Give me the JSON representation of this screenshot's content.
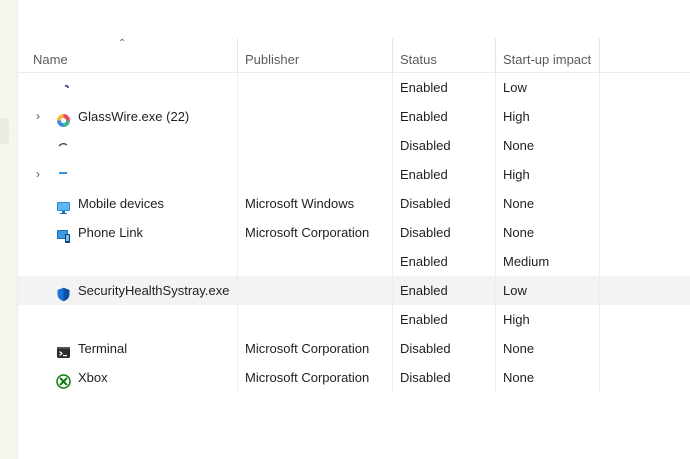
{
  "columns": {
    "name": "Name",
    "publisher": "Publisher",
    "status": "Status",
    "impact": "Start-up impact"
  },
  "rows": [
    {
      "name": "",
      "publisher": "",
      "status": "Enabled",
      "impact": "Low",
      "icon": "redacted-app-icon",
      "expandable": false
    },
    {
      "name": "GlassWire.exe (22)",
      "publisher": "",
      "status": "Enabled",
      "impact": "High",
      "icon": "glasswire-icon",
      "expandable": true
    },
    {
      "name": "",
      "publisher": "",
      "status": "Disabled",
      "impact": "None",
      "icon": "redacted-app-icon",
      "expandable": false
    },
    {
      "name": "",
      "publisher": "",
      "status": "Enabled",
      "impact": "High",
      "icon": "redacted-app-icon",
      "expandable": true
    },
    {
      "name": "Mobile devices",
      "publisher": "Microsoft Windows",
      "status": "Disabled",
      "impact": "None",
      "icon": "mobile-devices-icon",
      "expandable": false
    },
    {
      "name": "Phone Link",
      "publisher": "Microsoft Corporation",
      "status": "Disabled",
      "impact": "None",
      "icon": "phone-link-icon",
      "expandable": false
    },
    {
      "name": "",
      "publisher": "",
      "status": "Enabled",
      "impact": "Medium",
      "icon": "redacted-app-icon",
      "expandable": false
    },
    {
      "name": "SecurityHealthSystray.exe",
      "publisher": "",
      "status": "Enabled",
      "impact": "Low",
      "icon": "shield-icon",
      "expandable": false,
      "selected": true
    },
    {
      "name": "",
      "publisher": "",
      "status": "Enabled",
      "impact": "High",
      "icon": "redacted-app-icon",
      "expandable": false
    },
    {
      "name": "Terminal",
      "publisher": "Microsoft Corporation",
      "status": "Disabled",
      "impact": "None",
      "icon": "terminal-icon",
      "expandable": false
    },
    {
      "name": "Xbox",
      "publisher": "Microsoft Corporation",
      "status": "Disabled",
      "impact": "None",
      "icon": "xbox-icon",
      "expandable": false
    }
  ],
  "colors": {
    "accent_blue": "#1a73d9",
    "selected_row": "#f3f3f3",
    "header_text": "#5b5b5b"
  }
}
